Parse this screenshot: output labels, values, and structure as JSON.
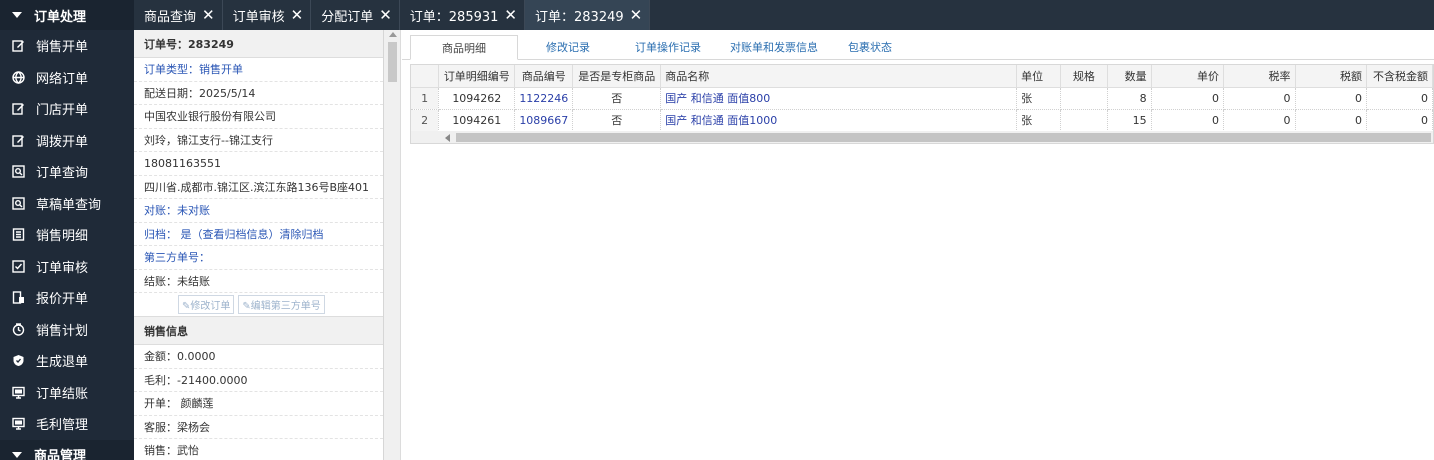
{
  "sidebar": {
    "section_title": "订单处理",
    "items": [
      {
        "label": "销售开单",
        "icon": "edit-icon"
      },
      {
        "label": "网络订单",
        "icon": "globe-icon"
      },
      {
        "label": "门店开单",
        "icon": "edit-icon"
      },
      {
        "label": "调拨开单",
        "icon": "edit-icon"
      },
      {
        "label": "订单查询",
        "icon": "image-search-icon"
      },
      {
        "label": "草稿单查询",
        "icon": "image-search-icon"
      },
      {
        "label": "销售明细",
        "icon": "list-icon"
      },
      {
        "label": "订单审核",
        "icon": "checkbox-icon"
      },
      {
        "label": "报价开单",
        "icon": "quote-icon"
      },
      {
        "label": "销售计划",
        "icon": "clock-icon"
      },
      {
        "label": "生成退单",
        "icon": "shield-icon"
      },
      {
        "label": "订单结账",
        "icon": "monitor-icon"
      },
      {
        "label": "毛利管理",
        "icon": "monitor-icon"
      }
    ],
    "next_section_title": "商品管理"
  },
  "tabs": [
    {
      "label": "商品查询",
      "active": false
    },
    {
      "label": "订单审核",
      "active": false
    },
    {
      "label": "分配订单",
      "active": false
    },
    {
      "label": "订单：285931",
      "active": false
    },
    {
      "label": "订单：283249",
      "active": true
    }
  ],
  "order": {
    "header": "订单号：283249",
    "type": "订单类型：销售开单",
    "date": "配送日期：2025/5/14",
    "company": "中国农业银行股份有限公司",
    "contact": "刘玲，锦江支行--锦江支行",
    "phone": "18081163551",
    "address": "四川省.成都市.锦江区.滨江东路136号B座401",
    "reconcile": "对账：未对账",
    "archive": "归档： 是（查看归档信息）清除归档",
    "third_party": "第三方单号：",
    "settle": "结账：未结账",
    "btn_modify": "修改订单",
    "btn_edit_third": "编辑第三方单号"
  },
  "sales": {
    "header": "销售信息",
    "amount": "金额：0.0000",
    "profit": "毛利：-21400.0000",
    "opener": "开单： 颜麟莲",
    "service": "客服：梁杨会",
    "seller": "销售：武怡"
  },
  "subtabs": [
    {
      "label": "商品明细",
      "active": true
    },
    {
      "label": "修改记录",
      "active": false
    },
    {
      "label": "订单操作记录",
      "active": false
    },
    {
      "label": "对账单和发票信息",
      "active": false
    },
    {
      "label": "包裹状态",
      "active": false
    }
  ],
  "grid": {
    "columns": [
      "",
      "订单明细编号",
      "商品编号",
      "是否是专柜商品",
      "商品名称",
      "单位",
      "规格",
      "数量",
      "单价",
      "税率",
      "税额",
      "不含税金额"
    ],
    "rows": [
      [
        "1",
        "1094262",
        "1122246",
        "否",
        "国产 和信通 面值800",
        "张",
        "",
        "8",
        "0",
        "0",
        "0",
        "0"
      ],
      [
        "2",
        "1094261",
        "1089667",
        "否",
        "国产 和信通 面值1000",
        "张",
        "",
        "15",
        "0",
        "0",
        "0",
        "0"
      ]
    ]
  }
}
